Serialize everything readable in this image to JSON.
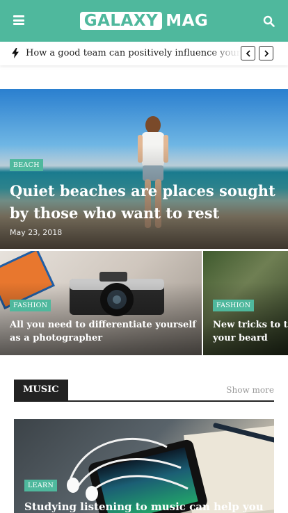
{
  "header": {
    "logo_part1": "GALAXY",
    "logo_part2": "MAG",
    "menu_icon": "hamburger-menu-icon",
    "search_icon": "search-icon",
    "accent_color": "#4fb89d"
  },
  "ticker": {
    "icon": "bolt-icon",
    "headline": "How a good team can positively influence your business",
    "prev_icon": "chevron-left-icon",
    "next_icon": "chevron-right-icon"
  },
  "hero": {
    "category": "BEACH",
    "title": "Quiet beaches are places sought by those who want to rest",
    "date": "May 23, 2018"
  },
  "cards": [
    {
      "category": "FASHION",
      "title": "All you need to differentiate yourself as a photographer"
    },
    {
      "category": "FASHION",
      "title": "New tricks to take care of your beard"
    }
  ],
  "music_section": {
    "label": "MUSIC",
    "show_more": "Show more",
    "article": {
      "category": "LEARN",
      "title": "Studying listening to music can help you"
    }
  }
}
